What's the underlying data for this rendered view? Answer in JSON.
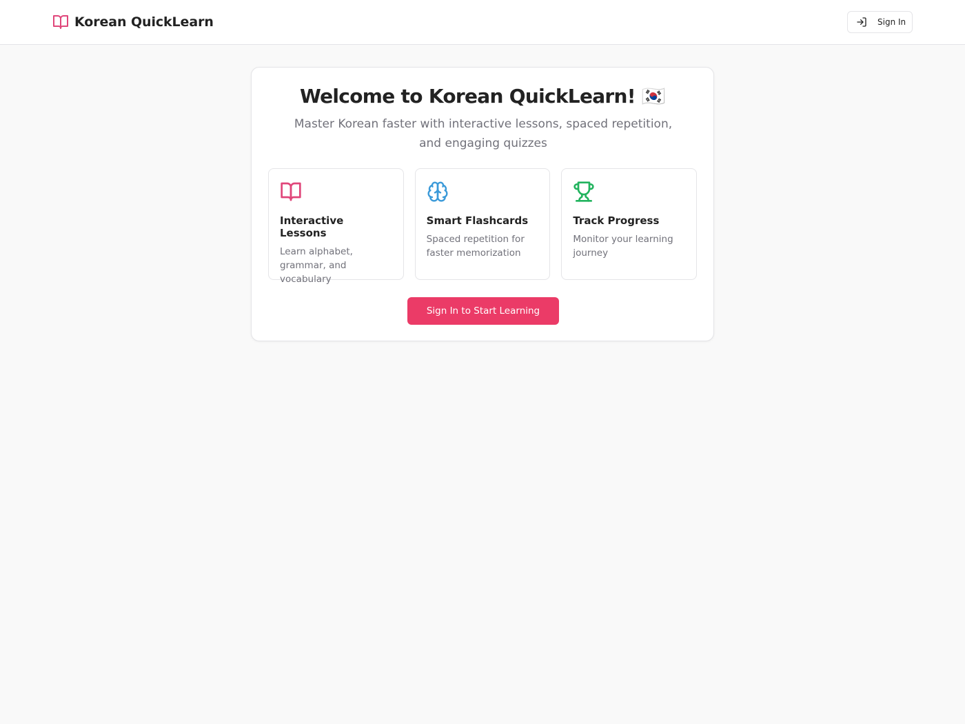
{
  "header": {
    "app_name": "Korean QuickLearn",
    "logo_icon": "book-open-icon",
    "signin_icon": "log-in-icon",
    "signin_label": "Sign In"
  },
  "welcome": {
    "title": "Welcome to Korean QuickLearn! 🇰🇷",
    "subtitle": "Master Korean faster with interactive lessons, spaced repetition, and engaging quizzes"
  },
  "features": [
    {
      "icon": "book-open-icon",
      "icon_color": "#e0467a",
      "title": "Interactive Lessons",
      "description": "Learn alphabet, grammar, and vocabulary"
    },
    {
      "icon": "brain-icon",
      "icon_color": "#3b9ad9",
      "title": "Smart Flashcards",
      "description": "Spaced repetition for faster memorization"
    },
    {
      "icon": "trophy-icon",
      "icon_color": "#22b35e",
      "title": "Track Progress",
      "description": "Monitor your learning journey"
    }
  ],
  "cta": {
    "label": "Sign In to Start Learning"
  },
  "colors": {
    "accent": "#eb3b67",
    "page_background": "#f9f9f9"
  }
}
